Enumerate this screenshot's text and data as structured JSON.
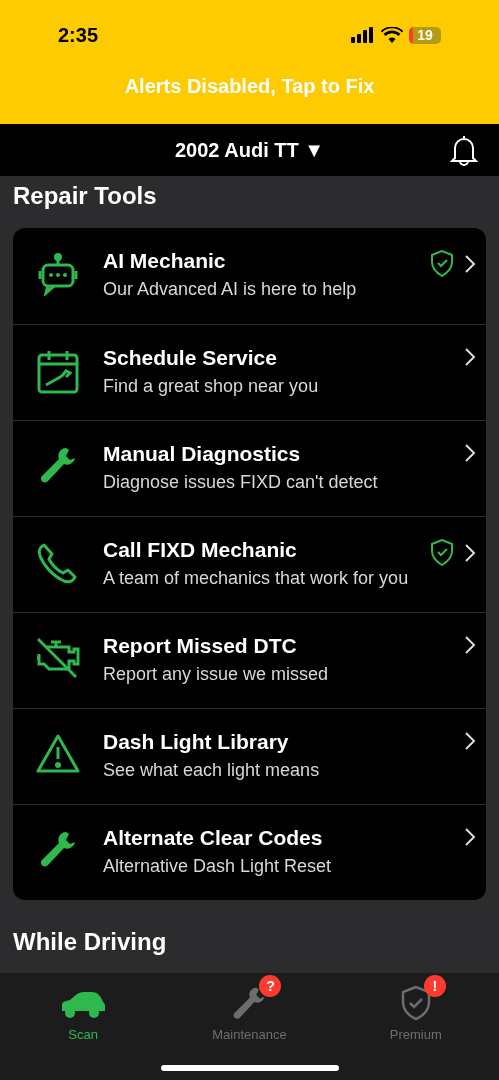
{
  "status_bar": {
    "time": "2:35",
    "battery": "19"
  },
  "banner": {
    "text": "Alerts Disabled, Tap to Fix"
  },
  "header": {
    "vehicle": "2002 Audi TT ▼"
  },
  "sections": [
    {
      "title": "Repair Tools",
      "items": [
        {
          "kind": "robot",
          "title": "AI Mechanic",
          "subtitle": "Our Advanced AI is here to help",
          "premium": true
        },
        {
          "kind": "calendar",
          "title": "Schedule Service",
          "subtitle": "Find a great shop near you",
          "premium": false
        },
        {
          "kind": "wrench",
          "title": "Manual Diagnostics",
          "subtitle": "Diagnose issues FIXD can't detect",
          "premium": false
        },
        {
          "kind": "phone",
          "title": "Call FIXD Mechanic",
          "subtitle": "A team of mechanics that work for you",
          "premium": true
        },
        {
          "kind": "engine",
          "title": "Report Missed DTC",
          "subtitle": "Report any issue we missed",
          "premium": false
        },
        {
          "kind": "warning",
          "title": "Dash Light Library",
          "subtitle": "See what each light means",
          "premium": false
        },
        {
          "kind": "wrench",
          "title": "Alternate Clear Codes",
          "subtitle": "Alternative Dash Light Reset",
          "premium": false
        }
      ]
    },
    {
      "title": "While Driving"
    }
  ],
  "tab_bar": [
    {
      "kind": "car",
      "label": "Scan",
      "selected": true
    },
    {
      "kind": "wrench",
      "label": "Maintenance",
      "selected": false,
      "badge": "?"
    },
    {
      "kind": "shield",
      "label": "Premium",
      "selected": false,
      "badge": "!"
    }
  ]
}
